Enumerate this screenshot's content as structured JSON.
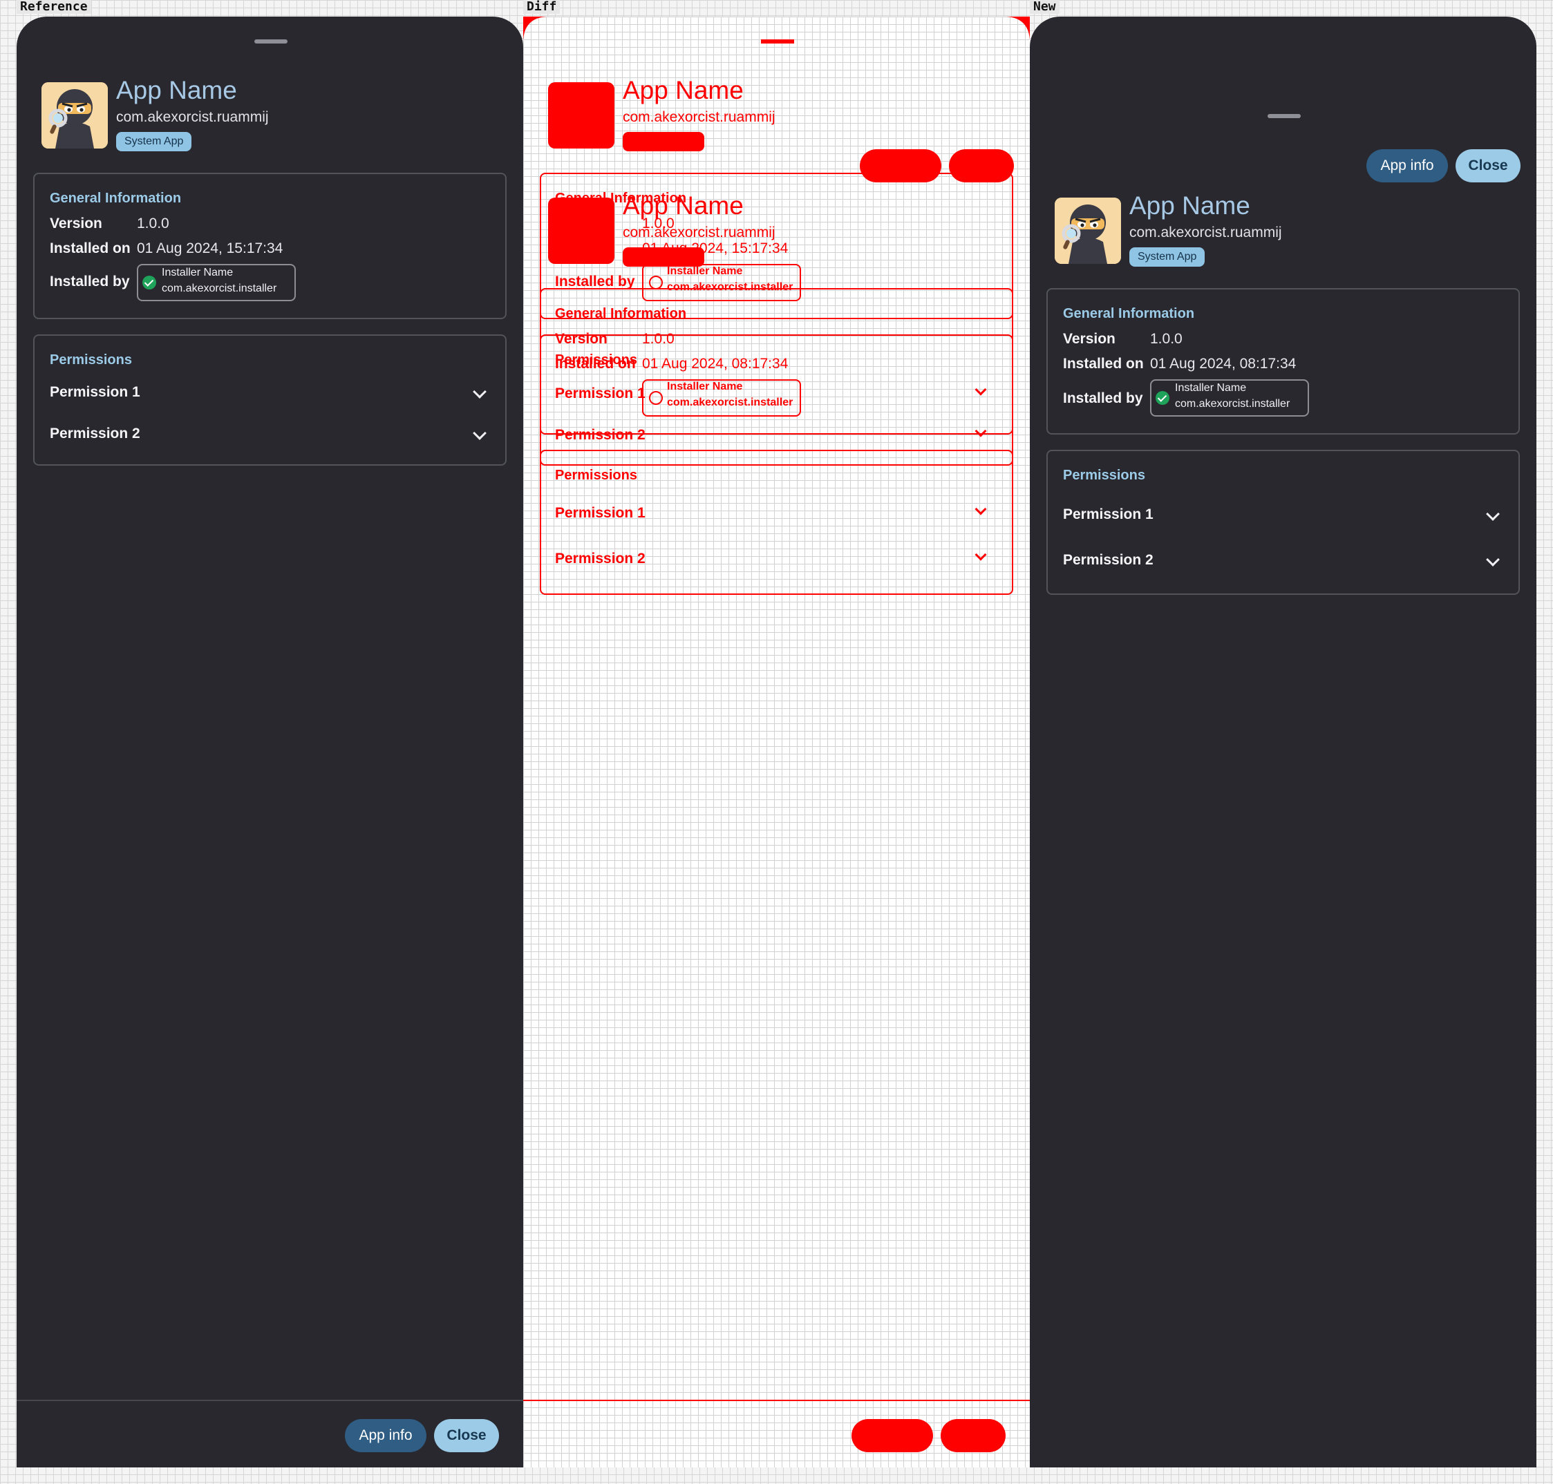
{
  "captions": {
    "reference": "Reference",
    "diff": "Diff",
    "new": "New"
  },
  "app": {
    "name": "App Name",
    "package": "com.akexorcist.ruammij",
    "badge": "System App",
    "icon": "ninja-detective-mascot-icon"
  },
  "general": {
    "title": "General Information",
    "version_label": "Version",
    "version": "1.0.0",
    "installed_on_label": "Installed on",
    "installed_by_label": "Installed by",
    "installer_name": "Installer Name",
    "installer_package": "com.akexorcist.installer",
    "verified_icon": "check-circle-icon"
  },
  "reference": {
    "installed_on": "01 Aug 2024, 15:17:34"
  },
  "new": {
    "installed_on": "01 Aug 2024, 08:17:34"
  },
  "permissions": {
    "title": "Permissions",
    "items": [
      {
        "label": "Permission 1",
        "icon": "chevron-down-icon"
      },
      {
        "label": "Permission 2",
        "icon": "chevron-down-icon"
      }
    ]
  },
  "buttons": {
    "app_info": "App info",
    "close": "Close"
  },
  "colors": {
    "sheet_background": "#28282e",
    "accent_title": "#a7c9e6",
    "primary_button": "#2f5d84",
    "secondary_button": "#9ccbe8",
    "verified": "#1fa25a",
    "diff_highlight": "#ff0000"
  }
}
